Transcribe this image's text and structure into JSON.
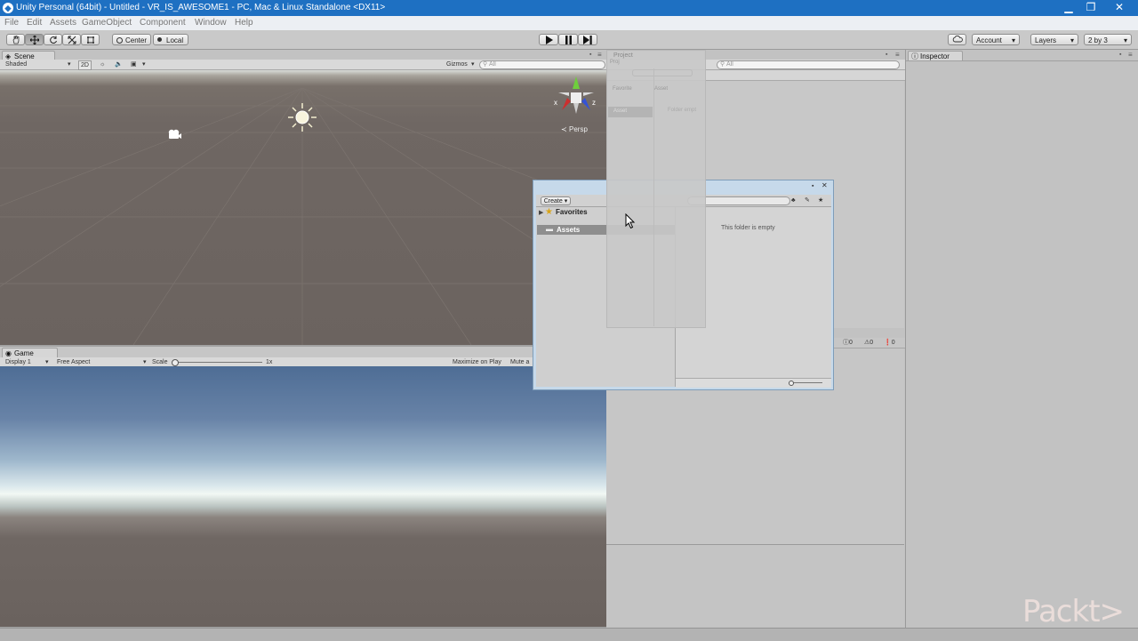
{
  "window": {
    "title": "Unity Personal (64bit) - Untitled - VR_IS_AWESOME1 - PC, Mac & Linux Standalone <DX11>",
    "icon_letter": "◆",
    "minimize": "▁",
    "restore": "❐",
    "close": "✕"
  },
  "menu": [
    "File",
    "Edit",
    "Assets",
    "GameObject",
    "Component",
    "Window",
    "Help"
  ],
  "toolbar": {
    "pivot_center": "Center",
    "pivot_local": "Local",
    "account": "Account",
    "layers": "Layers",
    "layout": "2 by 3"
  },
  "scene": {
    "tab": "Scene",
    "shading": "Shaded",
    "mode_2d": "2D",
    "gizmos": "Gizmos",
    "search_placeholder": "All",
    "persp": "Persp",
    "axis_x": "x",
    "axis_z": "z"
  },
  "game": {
    "tab": "Game",
    "display": "Display 1",
    "aspect": "Free Aspect",
    "scale_label": "Scale",
    "scale_value": "1x",
    "maximize": "Maximize on Play",
    "mute": "Mute a"
  },
  "project_ghost": {
    "tab": "Project",
    "create": "Proj",
    "favorites": "Favorite",
    "assets": "Asset",
    "assets_sel": "Asset",
    "empty": "Folder empt"
  },
  "project_popup": {
    "create": "Create",
    "favorites": "Favorites",
    "assets": "Assets",
    "empty_message": "This folder is empty"
  },
  "hierarchy": {
    "search_placeholder": "All"
  },
  "console": {
    "counts": [
      "0",
      "0",
      "0"
    ]
  },
  "inspector": {
    "tab": "Inspector"
  },
  "watermark": "Packt>"
}
